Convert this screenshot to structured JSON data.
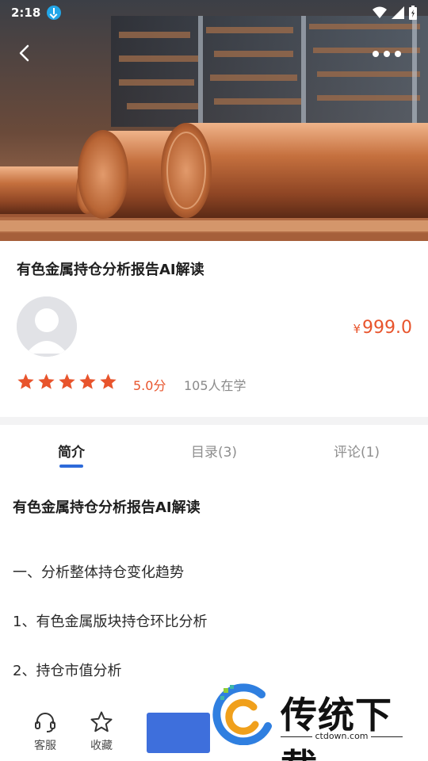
{
  "status_bar": {
    "time": "2:18",
    "icons": [
      "download-notification-icon",
      "wifi-icon",
      "signal-icon",
      "battery-icon"
    ]
  },
  "header": {
    "back_icon": "chevron-left-icon",
    "more_icon": "more-dots-icon"
  },
  "course": {
    "title": "有色金属持仓分析报告AI解读",
    "price_symbol": "¥",
    "price": "999.0",
    "rating_stars": 5,
    "score": "5.0分",
    "learners": "105人在学"
  },
  "tabs": [
    {
      "label": "简介",
      "active": true
    },
    {
      "label": "目录(3)",
      "active": false
    },
    {
      "label": "评论(1)",
      "active": false
    }
  ],
  "intro": {
    "title": "有色金属持仓分析报告AI解读",
    "lines": [
      "一、分析整体持仓变化趋势",
      "1、有色金属版块持仓环比分析",
      "2、持仓市值分析"
    ]
  },
  "bottom_bar": {
    "service_label": "客服",
    "favorite_label": "收藏"
  },
  "watermark": {
    "text": "传统下载",
    "url": "ctdown.com"
  },
  "colors": {
    "accent": "#e8542c",
    "primary": "#3e6fdc",
    "tab_indicator": "#2d6ad9"
  }
}
